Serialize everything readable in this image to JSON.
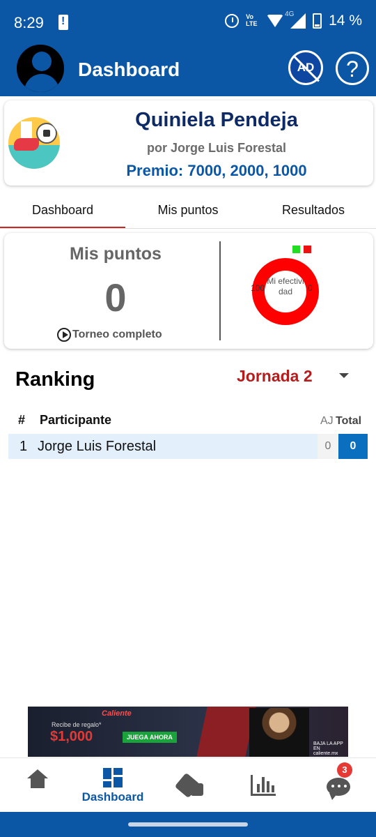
{
  "status_bar": {
    "time": "8:29",
    "battery_pct": "14 %",
    "network": "4G",
    "volte": "Vo LTE"
  },
  "app_bar": {
    "title": "Dashboard",
    "ad_label": "AD",
    "help_label": "?"
  },
  "quiniela": {
    "title": "Quiniela Pendeja",
    "author": "por Jorge Luis Forestal",
    "prize": "Premio: 7000, 2000, 1000"
  },
  "tabs": [
    {
      "label": "Dashboard",
      "active": true
    },
    {
      "label": "Mis puntos",
      "active": false
    },
    {
      "label": "Resultados",
      "active": false
    }
  ],
  "points": {
    "label": "Mis puntos",
    "value": "0",
    "torneo_label": "Torneo completo"
  },
  "effectiveness": {
    "label": "Mi efectividad",
    "left_value": "100",
    "right_value": "0",
    "colors": {
      "green": "#22dd22",
      "red": "#ee1111"
    }
  },
  "ranking": {
    "title": "Ranking",
    "jornada": "Jornada 2",
    "headers": {
      "rank": "#",
      "participant": "Participante",
      "aj": "AJ",
      "total": "Total"
    },
    "rows": [
      {
        "rank": "1",
        "name": "Jorge Luis Forestal",
        "aj": "0",
        "total": "0"
      }
    ]
  },
  "ad_banner": {
    "brand": "Caliente",
    "gift_text": "Recibe de regalo*",
    "amount": "$1,000",
    "cta": "JUEGA AHORA",
    "app_text": "BAJA LA APP EN caliente.mx"
  },
  "bottom_nav": {
    "items": [
      {
        "icon": "home-icon",
        "label": ""
      },
      {
        "icon": "dashboard-icon",
        "label": "Dashboard",
        "active": true
      },
      {
        "icon": "dice-icon",
        "label": ""
      },
      {
        "icon": "stats-icon",
        "label": ""
      },
      {
        "icon": "chat-icon",
        "label": "",
        "badge": "3"
      }
    ]
  },
  "colors": {
    "primary": "#0b57a6",
    "accent_red": "#b71c1c",
    "title_navy": "#0d2a66"
  }
}
